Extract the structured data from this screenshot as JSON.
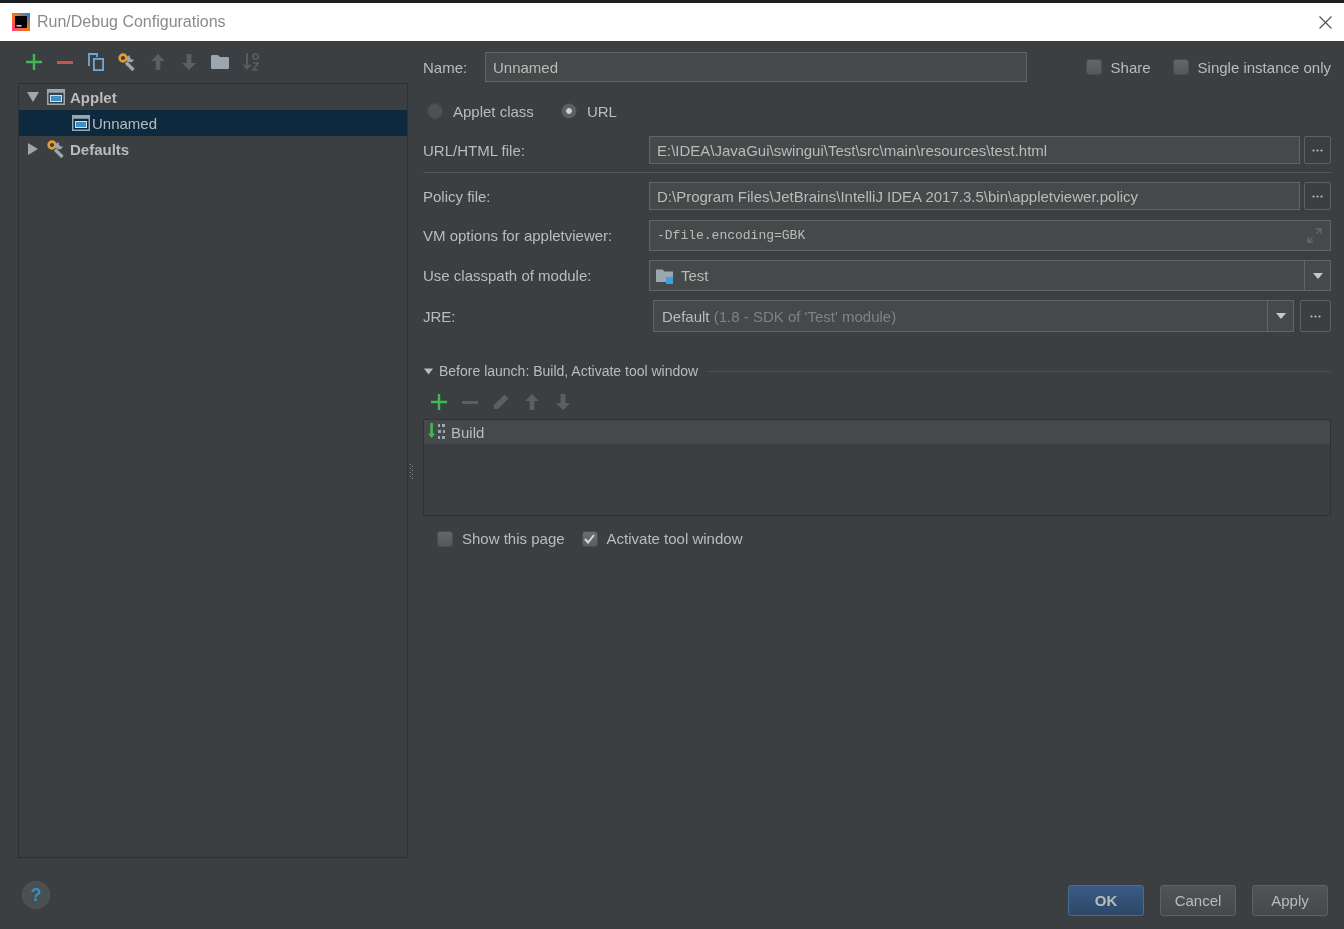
{
  "window": {
    "title": "Run/Debug Configurations"
  },
  "sidebar": {
    "toolbar": [
      {
        "kind": "add",
        "disabled": false
      },
      {
        "kind": "remove",
        "disabled": false
      },
      {
        "kind": "copy",
        "disabled": false
      },
      {
        "kind": "defaults",
        "disabled": false
      },
      {
        "kind": "move-up",
        "disabled": true
      },
      {
        "kind": "move-down",
        "disabled": true
      },
      {
        "kind": "folder",
        "disabled": false
      },
      {
        "kind": "sort",
        "disabled": true
      }
    ],
    "tree": [
      {
        "kind": "applet",
        "label": "Applet",
        "expanded": true,
        "selected": false,
        "children": [
          {
            "kind": "applet",
            "label": "Unnamed",
            "selected": true
          }
        ]
      },
      {
        "kind": "defaults",
        "label": "Defaults",
        "expanded": false,
        "selected": false
      }
    ]
  },
  "name_field": {
    "label": "Name:",
    "value": "Unnamed"
  },
  "options": [
    {
      "label": "Share",
      "checked": false
    },
    {
      "label": "Single instance only",
      "checked": false
    }
  ],
  "mode": [
    {
      "label": "Applet class",
      "selected": false
    },
    {
      "label": "URL",
      "selected": true
    }
  ],
  "fields": [
    {
      "kind": "file",
      "label": "URL/HTML file:",
      "value": "E:\\IDEA\\JavaGui\\swingui\\Test\\src\\main\\resources\\test.html"
    },
    {
      "kind": "file",
      "label": "Policy file:",
      "value": "D:\\Program Files\\JetBrains\\IntelliJ IDEA 2017.3.5\\bin\\appletviewer.policy"
    },
    {
      "kind": "expand",
      "label": "VM options for appletviewer:",
      "value": "-Dfile.encoding=GBK"
    },
    {
      "kind": "module",
      "label": "Use classpath of module:",
      "value": "Test"
    },
    {
      "kind": "jre",
      "label": "JRE:",
      "value": "Default",
      "detail": "(1.8 - SDK of 'Test' module)"
    }
  ],
  "before_launch": {
    "title": "Before launch: Build, Activate tool window",
    "expanded": true,
    "toolbar": [
      {
        "kind": "add",
        "disabled": false
      },
      {
        "kind": "remove",
        "disabled": true
      },
      {
        "kind": "edit",
        "disabled": true
      },
      {
        "kind": "move-up",
        "disabled": true
      },
      {
        "kind": "move-down",
        "disabled": true
      }
    ],
    "tasks": [
      {
        "label": "Build",
        "selected": true
      }
    ],
    "options": [
      {
        "label": "Show this page",
        "checked": false
      },
      {
        "label": "Activate tool window",
        "checked": true
      }
    ]
  },
  "help_button": {
    "label": "?"
  },
  "buttons": [
    {
      "label": "OK",
      "default": true
    },
    {
      "label": "Cancel",
      "default": false
    },
    {
      "label": "Apply",
      "default": false
    }
  ]
}
